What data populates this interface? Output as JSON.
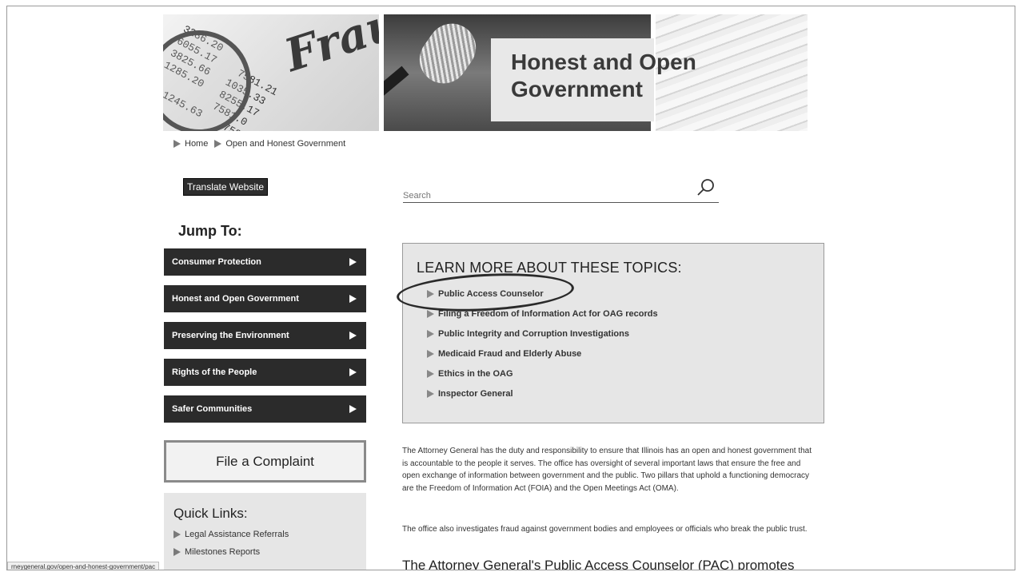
{
  "banner": {
    "title": "Honest and Open Government",
    "script_word": "Fraud",
    "ledger_numbers": "3286.20\n6055.17    7581.21\n3825.66   1035.33\n1285.20   8255.17\n          7581.0\n  1245.63    7581.0"
  },
  "breadcrumb": {
    "items": [
      "Home",
      "Open and Honest Government"
    ]
  },
  "translate": {
    "label": "Translate Website"
  },
  "search": {
    "placeholder": "Search"
  },
  "jump_to": {
    "title": "Jump To:",
    "items": [
      "Consumer Protection",
      "Honest and Open Government",
      "Preserving the Environment",
      "Rights of the People",
      "Safer Communities"
    ]
  },
  "complaint": {
    "label": "File a Complaint"
  },
  "quick_links": {
    "title": "Quick Links:",
    "items": [
      "Legal Assistance Referrals",
      "Milestones Reports"
    ]
  },
  "topics": {
    "title": "LEARN MORE ABOUT THESE TOPICS:",
    "items": [
      "Public Access Counselor",
      "Filing a Freedom of Information Act for OAG records",
      "Public Integrity and Corruption Investigations",
      "Medicaid Fraud and Elderly Abuse",
      "Ethics in the OAG",
      "Inspector General"
    ]
  },
  "content": {
    "paragraph1": "The Attorney General has the duty and responsibility to ensure that Illinois has an open and honest government that is accountable to the people it serves. The office has oversight of several important laws that ensure the free and open exchange of information between government and the public. Two pillars that uphold a functioning democracy are the Freedom of Information Act (FOIA) and the Open Meetings Act (OMA).",
    "paragraph2": "The office also investigates fraud against government bodies and employees or officials who break the public trust.",
    "heading": "The Attorney General's Public Access Counselor (PAC) promotes"
  },
  "status_bar": {
    "url": "rneygeneral.gov/open-and-honest-government/pac"
  },
  "colors": {
    "dark_nav": "#2b2b2b",
    "panel": "#e6e6e6",
    "border": "#9a9a9a"
  }
}
